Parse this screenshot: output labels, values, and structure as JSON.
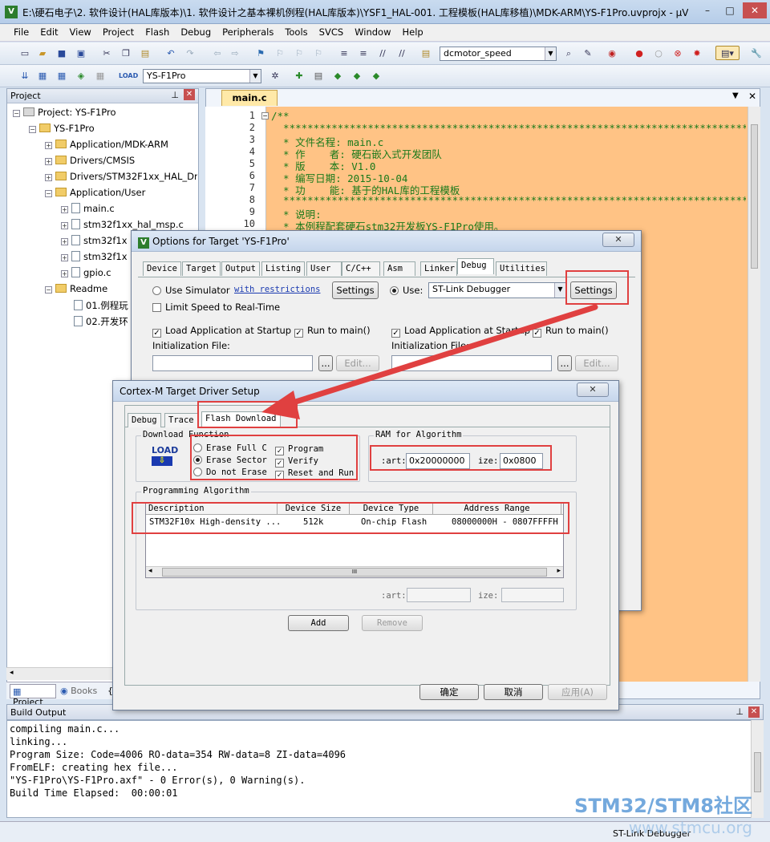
{
  "window": {
    "title": "E:\\硬石电子\\2. 软件设计(HAL库版本)\\1. 软件设计之基本裸机例程(HAL库版本)\\YSF1_HAL-001. 工程模板(HAL库移植)\\MDK-ARM\\YS-F1Pro.uvprojx - µVision",
    "min": "–",
    "max": "□",
    "close": "✕"
  },
  "menu": [
    "File",
    "Edit",
    "View",
    "Project",
    "Flash",
    "Debug",
    "Peripherals",
    "Tools",
    "SVCS",
    "Window",
    "Help"
  ],
  "toolbar": {
    "find_combo": "dcmotor_speed",
    "target_combo": "YS-F1Pro"
  },
  "project": {
    "header": "Project",
    "root": "Project: YS-F1Pro",
    "target": "YS-F1Pro",
    "groups": [
      "Application/MDK-ARM",
      "Drivers/CMSIS",
      "Drivers/STM32F1xx_HAL_Driv",
      "Application/User"
    ],
    "user_files": [
      "main.c",
      "stm32f1xx_hal_msp.c",
      "stm32f1x",
      "stm32f1x",
      "gpio.c"
    ],
    "readme_group": "Readme",
    "readme_files": [
      "01.例程玩",
      "02.开发环"
    ],
    "tabs": [
      "Project",
      "Books",
      "{"
    ]
  },
  "editor": {
    "tab": "main.c",
    "line_numbers": [
      "1",
      "2",
      "3",
      "4",
      "5",
      "6",
      "7",
      "8",
      "9",
      "10"
    ],
    "lines": [
      "/**",
      "  ******************************************************************************",
      "  * 文件名程: main.c",
      "  * 作    者: 硬石嵌入式开发团队",
      "  * 版    本: V1.0",
      "  * 编写日期: 2015-10-04",
      "  * 功    能: 基于的HAL库的工程模板",
      "  ******************************************************************************",
      "  * 说明:",
      "  * 本例程配套硬石stm32开发板YS-F1Pro使用。"
    ]
  },
  "options_dialog": {
    "title": "Options for Target 'YS-F1Pro'",
    "close": "✕",
    "tabs": [
      "Device",
      "Target",
      "Output",
      "Listing",
      "User",
      "C/C++",
      "Asm",
      "Linker",
      "Debug",
      "Utilities"
    ],
    "use_simulator": "Use Simulator",
    "with_restrictions": "with restrictions",
    "settings_left": "Settings",
    "limit_speed": "Limit Speed to Real-Time",
    "use_label": "Use:",
    "debugger": "ST-Link Debugger",
    "settings_right": "Settings",
    "load_app_left": "Load Application at Startup",
    "run_main_left": "Run to main()",
    "init_file_left": "Initialization File:",
    "load_app_right": "Load Application at Startup",
    "run_main_right": "Run to main()",
    "init_file_right": "Initialization File:",
    "browse": "...",
    "edit": "Edit..."
  },
  "driver_dialog": {
    "title": "Cortex-M Target Driver Setup",
    "close": "✕",
    "tabs": [
      "Debug",
      "Trace",
      "Flash Download"
    ],
    "download_function": {
      "title": "Download Function",
      "load_icon": "LOAD",
      "erase_full": "Erase Full C",
      "erase_sector": "Erase Sector",
      "no_erase": "Do not Erase",
      "program": "Program",
      "verify": "Verify",
      "reset_run": "Reset and Run"
    },
    "ram": {
      "title": "RAM for Algorithm",
      "start_label": ":art:",
      "start_value": "0x20000000",
      "size_label": "ize:",
      "size_value": "0x0800"
    },
    "algorithm": {
      "title": "Programming Algorithm",
      "columns": [
        "Description",
        "Device Size",
        "Device Type",
        "Address Range"
      ],
      "rows": [
        [
          "STM32F10x High-density ...",
          "512k",
          "On-chip Flash",
          "08000000H - 0807FFFFH"
        ]
      ],
      "start_label": ":art:",
      "size_label": "ize:",
      "scroll_left": "◂",
      "scroll_right": "▸",
      "scroll_grip": "III"
    },
    "add": "Add",
    "remove": "Remove",
    "ok": "确定",
    "cancel": "取消",
    "apply": "应用(A)"
  },
  "build": {
    "header": "Build Output",
    "lines": [
      "compiling main.c...",
      "linking...",
      "Program Size: Code=4006 RO-data=354 RW-data=8 ZI-data=4096",
      "FromELF: creating hex file...",
      "\"YS-F1Pro\\YS-F1Pro.axf\" - 0 Error(s), 0 Warning(s).",
      "Build Time Elapsed:  00:00:01"
    ]
  },
  "status": {
    "debugger": "ST-Link Debugger"
  },
  "watermark": {
    "line1": "STM32/STM8社区",
    "line2": "www.stmcu.org"
  },
  "colors": {
    "highlight": "#e04040",
    "code_bg": "#ffc385",
    "comment": "#1a7a1a"
  }
}
